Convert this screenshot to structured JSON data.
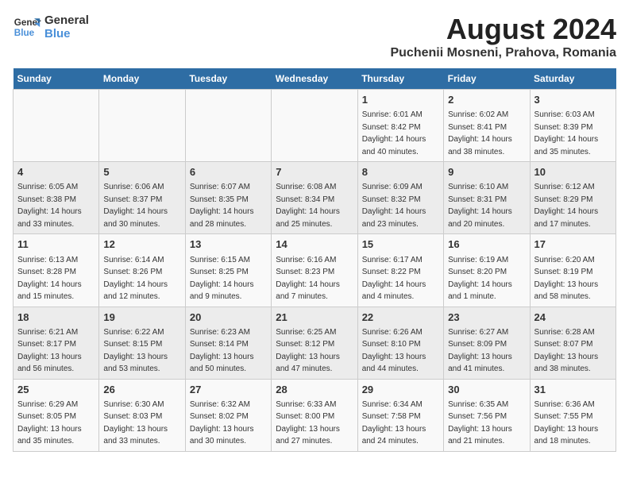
{
  "header": {
    "logo_line1": "General",
    "logo_line2": "Blue",
    "main_title": "August 2024",
    "subtitle": "Puchenii Mosneni, Prahova, Romania"
  },
  "weekdays": [
    "Sunday",
    "Monday",
    "Tuesday",
    "Wednesday",
    "Thursday",
    "Friday",
    "Saturday"
  ],
  "weeks": [
    [
      {
        "day": "",
        "info": ""
      },
      {
        "day": "",
        "info": ""
      },
      {
        "day": "",
        "info": ""
      },
      {
        "day": "",
        "info": ""
      },
      {
        "day": "1",
        "info": "Sunrise: 6:01 AM\nSunset: 8:42 PM\nDaylight: 14 hours and 40 minutes."
      },
      {
        "day": "2",
        "info": "Sunrise: 6:02 AM\nSunset: 8:41 PM\nDaylight: 14 hours and 38 minutes."
      },
      {
        "day": "3",
        "info": "Sunrise: 6:03 AM\nSunset: 8:39 PM\nDaylight: 14 hours and 35 minutes."
      }
    ],
    [
      {
        "day": "4",
        "info": "Sunrise: 6:05 AM\nSunset: 8:38 PM\nDaylight: 14 hours and 33 minutes."
      },
      {
        "day": "5",
        "info": "Sunrise: 6:06 AM\nSunset: 8:37 PM\nDaylight: 14 hours and 30 minutes."
      },
      {
        "day": "6",
        "info": "Sunrise: 6:07 AM\nSunset: 8:35 PM\nDaylight: 14 hours and 28 minutes."
      },
      {
        "day": "7",
        "info": "Sunrise: 6:08 AM\nSunset: 8:34 PM\nDaylight: 14 hours and 25 minutes."
      },
      {
        "day": "8",
        "info": "Sunrise: 6:09 AM\nSunset: 8:32 PM\nDaylight: 14 hours and 23 minutes."
      },
      {
        "day": "9",
        "info": "Sunrise: 6:10 AM\nSunset: 8:31 PM\nDaylight: 14 hours and 20 minutes."
      },
      {
        "day": "10",
        "info": "Sunrise: 6:12 AM\nSunset: 8:29 PM\nDaylight: 14 hours and 17 minutes."
      }
    ],
    [
      {
        "day": "11",
        "info": "Sunrise: 6:13 AM\nSunset: 8:28 PM\nDaylight: 14 hours and 15 minutes."
      },
      {
        "day": "12",
        "info": "Sunrise: 6:14 AM\nSunset: 8:26 PM\nDaylight: 14 hours and 12 minutes."
      },
      {
        "day": "13",
        "info": "Sunrise: 6:15 AM\nSunset: 8:25 PM\nDaylight: 14 hours and 9 minutes."
      },
      {
        "day": "14",
        "info": "Sunrise: 6:16 AM\nSunset: 8:23 PM\nDaylight: 14 hours and 7 minutes."
      },
      {
        "day": "15",
        "info": "Sunrise: 6:17 AM\nSunset: 8:22 PM\nDaylight: 14 hours and 4 minutes."
      },
      {
        "day": "16",
        "info": "Sunrise: 6:19 AM\nSunset: 8:20 PM\nDaylight: 14 hours and 1 minute."
      },
      {
        "day": "17",
        "info": "Sunrise: 6:20 AM\nSunset: 8:19 PM\nDaylight: 13 hours and 58 minutes."
      }
    ],
    [
      {
        "day": "18",
        "info": "Sunrise: 6:21 AM\nSunset: 8:17 PM\nDaylight: 13 hours and 56 minutes."
      },
      {
        "day": "19",
        "info": "Sunrise: 6:22 AM\nSunset: 8:15 PM\nDaylight: 13 hours and 53 minutes."
      },
      {
        "day": "20",
        "info": "Sunrise: 6:23 AM\nSunset: 8:14 PM\nDaylight: 13 hours and 50 minutes."
      },
      {
        "day": "21",
        "info": "Sunrise: 6:25 AM\nSunset: 8:12 PM\nDaylight: 13 hours and 47 minutes."
      },
      {
        "day": "22",
        "info": "Sunrise: 6:26 AM\nSunset: 8:10 PM\nDaylight: 13 hours and 44 minutes."
      },
      {
        "day": "23",
        "info": "Sunrise: 6:27 AM\nSunset: 8:09 PM\nDaylight: 13 hours and 41 minutes."
      },
      {
        "day": "24",
        "info": "Sunrise: 6:28 AM\nSunset: 8:07 PM\nDaylight: 13 hours and 38 minutes."
      }
    ],
    [
      {
        "day": "25",
        "info": "Sunrise: 6:29 AM\nSunset: 8:05 PM\nDaylight: 13 hours and 35 minutes."
      },
      {
        "day": "26",
        "info": "Sunrise: 6:30 AM\nSunset: 8:03 PM\nDaylight: 13 hours and 33 minutes."
      },
      {
        "day": "27",
        "info": "Sunrise: 6:32 AM\nSunset: 8:02 PM\nDaylight: 13 hours and 30 minutes."
      },
      {
        "day": "28",
        "info": "Sunrise: 6:33 AM\nSunset: 8:00 PM\nDaylight: 13 hours and 27 minutes."
      },
      {
        "day": "29",
        "info": "Sunrise: 6:34 AM\nSunset: 7:58 PM\nDaylight: 13 hours and 24 minutes."
      },
      {
        "day": "30",
        "info": "Sunrise: 6:35 AM\nSunset: 7:56 PM\nDaylight: 13 hours and 21 minutes."
      },
      {
        "day": "31",
        "info": "Sunrise: 6:36 AM\nSunset: 7:55 PM\nDaylight: 13 hours and 18 minutes."
      }
    ]
  ]
}
